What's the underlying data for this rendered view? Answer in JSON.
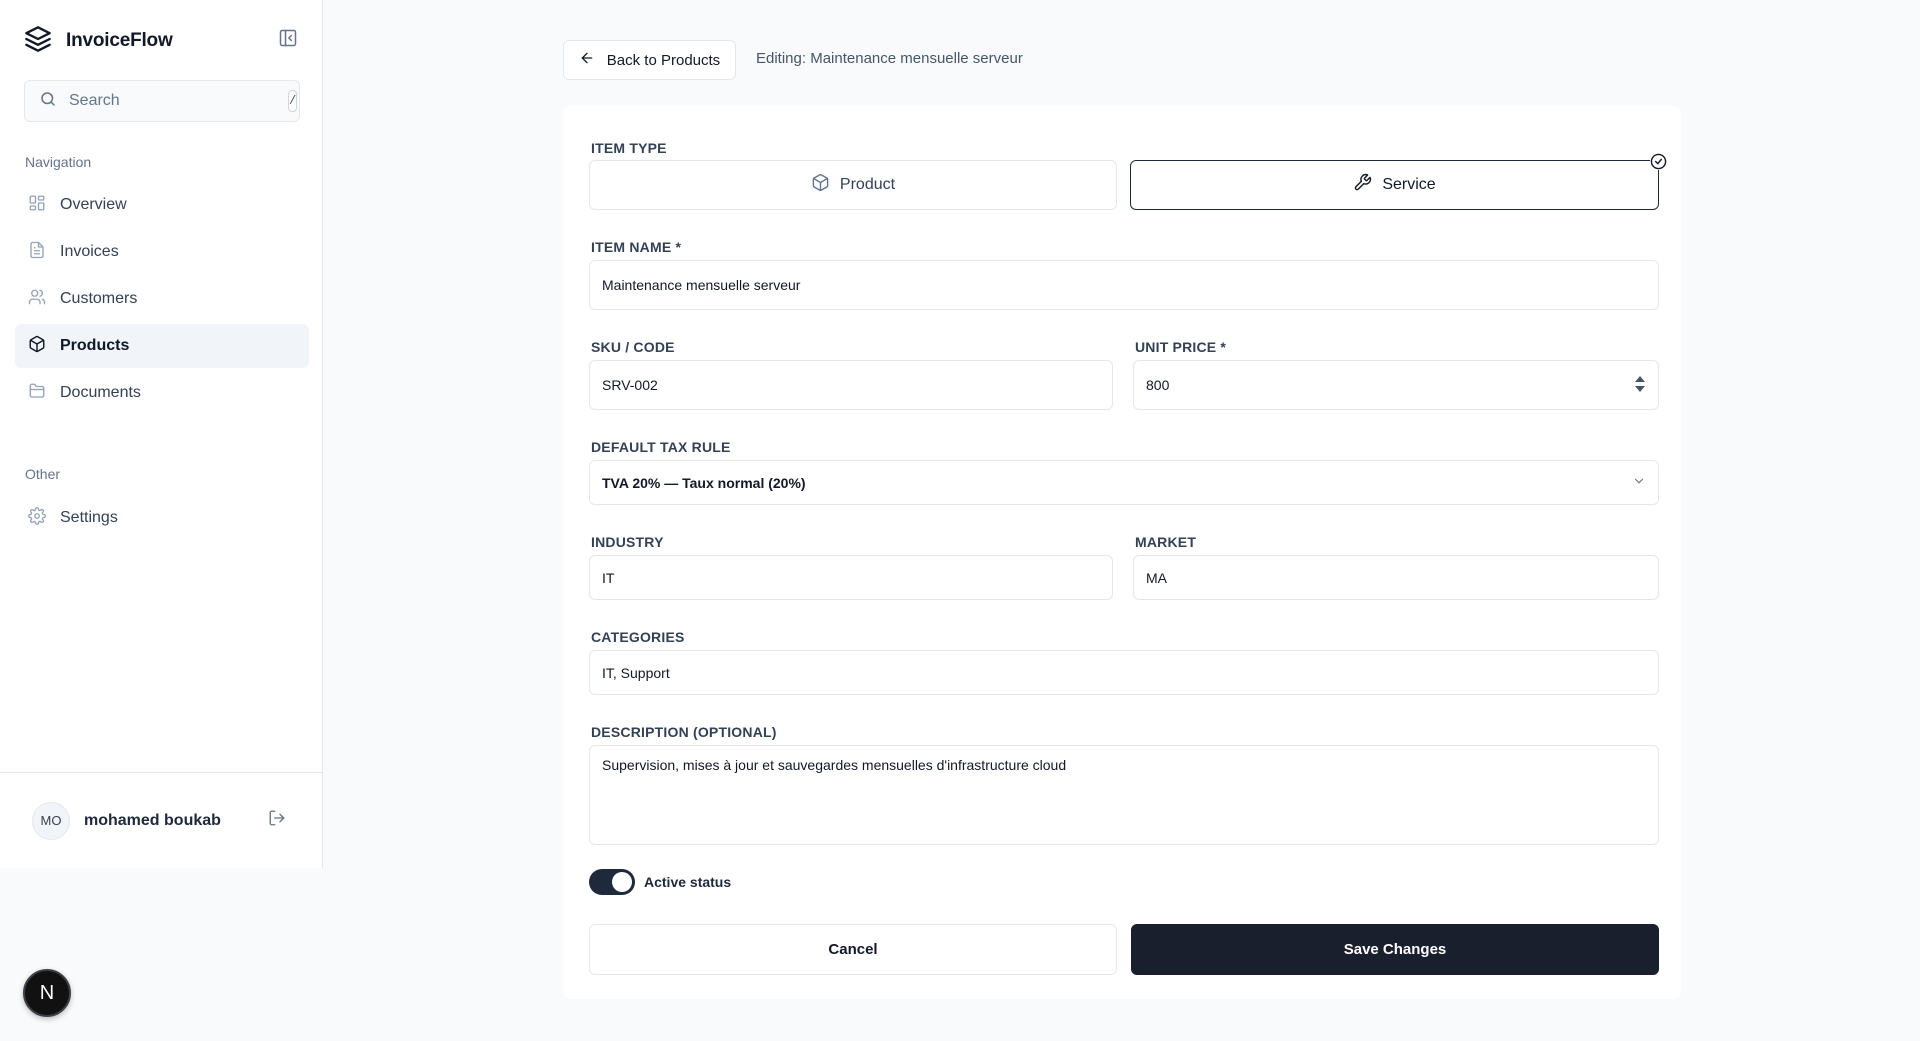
{
  "app": {
    "name": "InvoiceFlow"
  },
  "search": {
    "placeholder": "Search",
    "shortcut": "/"
  },
  "sidebar": {
    "nav_label": "Navigation",
    "items": [
      {
        "label": "Overview",
        "icon": "grid-icon"
      },
      {
        "label": "Invoices",
        "icon": "file-text-icon"
      },
      {
        "label": "Customers",
        "icon": "users-icon"
      },
      {
        "label": "Products",
        "icon": "package-icon",
        "active": true
      },
      {
        "label": "Documents",
        "icon": "folder-icon"
      }
    ],
    "other_label": "Other",
    "other_items": [
      {
        "label": "Settings",
        "icon": "gear-icon"
      }
    ]
  },
  "user": {
    "initials": "MO",
    "name": "mohamed boukab"
  },
  "badge": {
    "letter": "N"
  },
  "header": {
    "back_label": "Back to Products",
    "editing_text": "Editing: Maintenance mensuelle serveur"
  },
  "form": {
    "item_type_label": "ITEM TYPE",
    "item_types": [
      {
        "label": "Product",
        "icon": "box-icon",
        "selected": false
      },
      {
        "label": "Service",
        "icon": "wrench-icon",
        "selected": true
      }
    ],
    "item_name_label": "ITEM NAME *",
    "item_name_value": "Maintenance mensuelle serveur",
    "sku_label": "SKU / CODE",
    "sku_value": "SRV-002",
    "unit_price_label": "UNIT PRICE *",
    "unit_price_value": "800",
    "tax_label": "DEFAULT TAX RULE",
    "tax_value": "TVA 20% — Taux normal (20%)",
    "industry_label": "INDUSTRY",
    "industry_value": "IT",
    "market_label": "MARKET",
    "market_value": "MA",
    "categories_label": "CATEGORIES",
    "categories_value": "IT, Support",
    "description_label": "DESCRIPTION (OPTIONAL)",
    "description_value": "Supervision, mises à jour et sauvegardes mensuelles d'infrastructure cloud",
    "active_label": "Active status",
    "active": true,
    "cancel_label": "Cancel",
    "save_label": "Save Changes"
  },
  "colors": {
    "accent": "#1a1f2e",
    "border": "#e5e7eb",
    "muted": "#64748b"
  }
}
